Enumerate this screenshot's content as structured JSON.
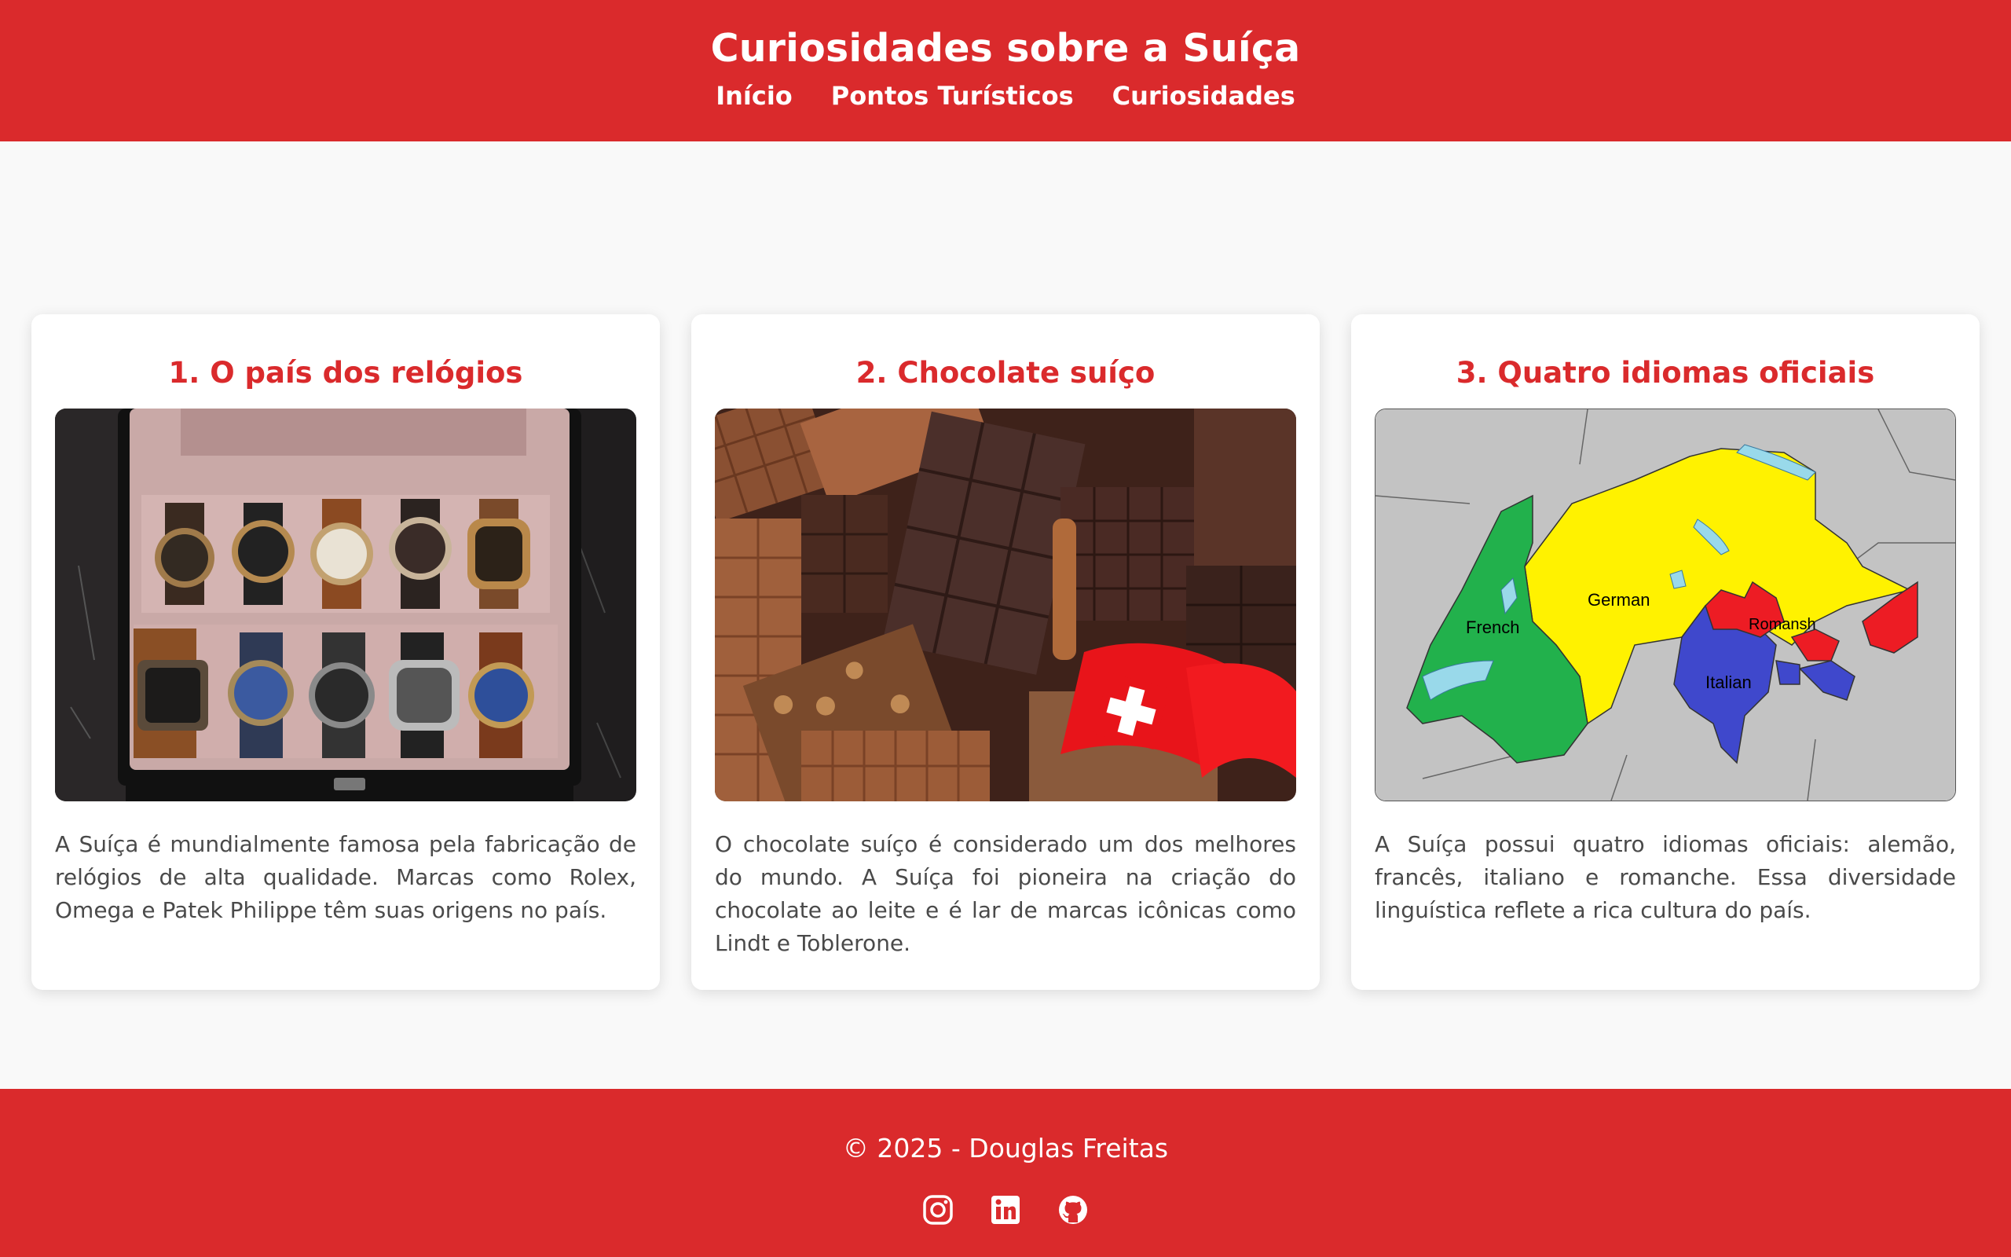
{
  "header": {
    "title": "Curiosidades sobre a Suíça",
    "nav": [
      "Início",
      "Pontos Turísticos",
      "Curiosidades"
    ]
  },
  "cards": [
    {
      "title": "1. O país dos relógios",
      "text": "A Suíça é mundialmente famosa pela fabricação de relógios de alta qualidade. Marcas como Rolex, Omega e Patek Philippe têm suas origens no país."
    },
    {
      "title": "2. Chocolate suíço",
      "text": "O chocolate suíço é considerado um dos melhores do mundo. A Suíça foi pioneira na criação do chocolate ao leite e é lar de marcas icônicas como Lindt e Toblerone."
    },
    {
      "title": "3. Quatro idiomas oficiais",
      "text": "A Suíça possui quatro idiomas oficiais: alemão, francês, italiano e romanche. Essa diversidade linguística reflete a rica cultura do país.",
      "map_labels": [
        "French",
        "German",
        "Romansh",
        "Italian"
      ]
    }
  ],
  "footer": {
    "copyright": "© 2025 - Douglas Freitas",
    "icons": [
      "instagram-icon",
      "linkedin-icon",
      "github-icon"
    ]
  },
  "colors": {
    "brand_red": "#da2a2c",
    "background": "#f9f9f9",
    "map_german": "#fff200",
    "map_french": "#22b14c",
    "map_italian": "#3f48cc",
    "map_romansh": "#ed1c24"
  }
}
